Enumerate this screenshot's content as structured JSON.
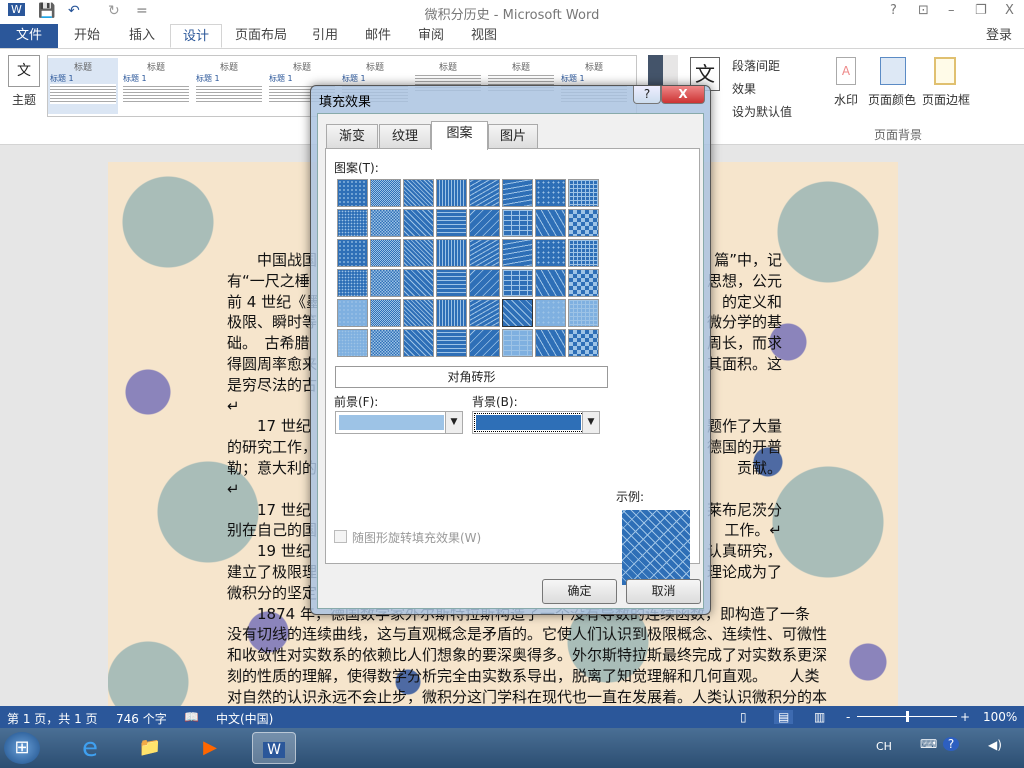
{
  "window": {
    "title": "微积分历史 - Microsoft Word",
    "help": "?",
    "restore_ribbon": "⊡",
    "minimize": "–",
    "maximize": "❐",
    "close": "X",
    "login": "登录"
  },
  "quick_access": {
    "word_icon": "W",
    "save": "💾",
    "undo": "↶",
    "redo": "↻",
    "customize": "="
  },
  "tabs": [
    "文件",
    "开始",
    "插入",
    "设计",
    "页面布局",
    "引用",
    "邮件",
    "审阅",
    "视图"
  ],
  "ribbon": {
    "theme": "主题",
    "gallery_items": [
      {
        "title": "标题",
        "heading": "标题 1"
      },
      {
        "title": "标题",
        "heading": "标题 1"
      },
      {
        "title": "标题",
        "heading": "标题 1"
      },
      {
        "title": "标题",
        "heading": "标题 1"
      },
      {
        "title": "标题",
        "heading": "标题 1"
      },
      {
        "title": "标题",
        "heading": ""
      },
      {
        "title": "标题",
        "heading": ""
      },
      {
        "title": "标题",
        "heading": "标题 1"
      }
    ],
    "paragraph_spacing": "段落间距",
    "effects": "效果",
    "set_default": "设为默认值",
    "watermark": "水印",
    "page_color": "页面颜色",
    "page_border": "页面边框",
    "group_page_background": "页面背景",
    "fonts_glyph": "文"
  },
  "document": {
    "lines": [
      [
        "　　中国战国",
        "篇”中，记"
      ],
      [
        "有“一尺之棰",
        "思想，公元"
      ],
      [
        "前 4 世纪《墨",
        "的定义和"
      ],
      [
        "极限、瞬时等",
        "微分学的基"
      ],
      [
        "础。　古希腊",
        "周长，而求"
      ],
      [
        "得圆周率愈来",
        "其面积。这"
      ],
      [
        "是穷尽法的古",
        ""
      ],
      [
        "↵",
        ""
      ],
      [
        "　　17 世纪",
        "题作了大量"
      ],
      [
        "的研究工作，",
        "德国的开普"
      ],
      [
        "勒；意大利的",
        "贡献。"
      ],
      [
        "↵",
        ""
      ],
      [
        "　　17 世纪",
        "莱布尼茨分"
      ],
      [
        "别在自己的国",
        "工作。↵"
      ],
      [
        "　　19 世纪",
        "认真研究，"
      ],
      [
        "建立了极限理",
        "理论成为了"
      ],
      [
        "微积分的坚定",
        ""
      ],
      [
        "　　1874 年，德国数学家外尔斯特拉斯构造了一个没有导数的连续函数，即构造了一条",
        ""
      ],
      [
        "没有切线的连续曲线，这与直观概念是矛盾的。它使人们认识到极限概念、连续性、可微性",
        ""
      ],
      [
        "和收敛性对实数系的依赖比人们想象的要深奥得多。外尔斯特拉斯最终完成了对实数系更深",
        ""
      ],
      [
        "刻的性质的理解，使得数学分析完全由实数系导出，脱离了知觉理解和几何直观。　　人类",
        ""
      ],
      [
        "对自然的认识永远不会止步，微积分这门学科在现代也一直在发展着。人类认识微积分的本",
        ""
      ]
    ]
  },
  "dialog": {
    "title": "填充效果",
    "help": "?",
    "close": "X",
    "tabs": [
      "渐变",
      "纹理",
      "图案",
      "图片"
    ],
    "active_tab": "图案",
    "pattern_label": "图案(T):",
    "selected_pattern": "对角砖形",
    "foreground_label": "前景(F):",
    "background_label": "背景(B):",
    "foreground_color": "#9dc3e6",
    "background_color": "#2e6fb7",
    "sample_label": "示例:",
    "rotate_checkbox": "随图形旋转填充效果(W)",
    "rotate_checked": false,
    "ok": "确定",
    "cancel": "取消"
  },
  "status": {
    "page": "第 1 页，共 1 页",
    "words": "746 个字",
    "proof_icon": "📖",
    "language": "中文(中国)",
    "zoom_minus": "-",
    "zoom_plus": "+",
    "zoom": "100%",
    "zoom_value": 100
  },
  "taskbar": {
    "ime": "CH",
    "time_hidden": ""
  }
}
